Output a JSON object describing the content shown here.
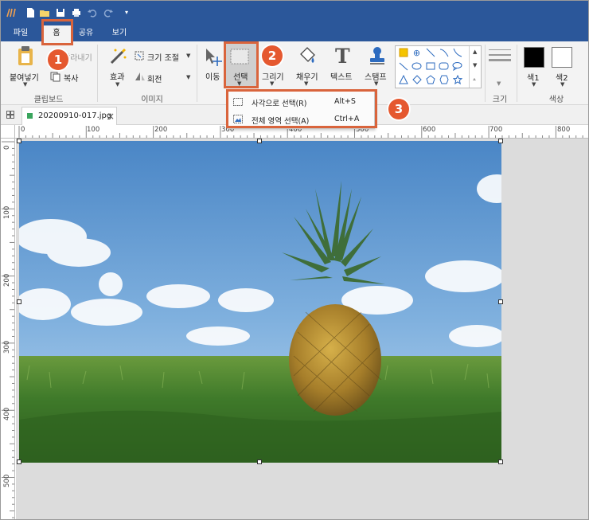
{
  "quick_access": {
    "icons": [
      "app-logo-icon",
      "new-icon",
      "open-icon",
      "save-icon",
      "print-icon",
      "undo-icon",
      "redo-icon",
      "customize-icon"
    ]
  },
  "tabs": [
    {
      "label": "파일",
      "active": false
    },
    {
      "label": "홈",
      "active": true
    },
    {
      "label": "공유",
      "active": false
    },
    {
      "label": "보기",
      "active": false
    }
  ],
  "ribbon": {
    "clipboard": {
      "paste": "붙여넣기",
      "cut": "잘라내기",
      "copy": "복사",
      "group_label": "클립보드"
    },
    "image": {
      "resize": "크기 조절",
      "effect": "효과",
      "rotate": "회전",
      "group_label": "이미지"
    },
    "tools": {
      "move": "이동",
      "select": "선택",
      "draw": "그리기",
      "fill": "채우기",
      "text": "텍스트",
      "stamp": "스탬프"
    },
    "shapes": [
      "select-box-icon",
      "crosshair-icon",
      "line-icon",
      "curve-icon",
      "arrow-line-icon",
      "ellipse-icon",
      "rectangle-icon",
      "rounded-rect-icon",
      "callout-icon",
      "triangle-icon",
      "diamond-icon",
      "pentagon-icon",
      "hexagon-icon",
      "star-icon"
    ],
    "size": {
      "group_label": "크기"
    },
    "color": {
      "color1": "색1",
      "color2": "색2",
      "group_label": "색상",
      "color1_value": "#000000",
      "color2_value": "#ffffff"
    }
  },
  "select_menu": {
    "items": [
      {
        "label": "사각으로 선택(R)",
        "shortcut": "Alt+S"
      },
      {
        "label": "전체 영역 선택(A)",
        "shortcut": "Ctrl+A"
      }
    ]
  },
  "document": {
    "tab_name": "20200910-017.jpg",
    "close": "×"
  },
  "ruler": {
    "h_labels": [
      "0",
      "100",
      "200",
      "300",
      "400",
      "500",
      "600",
      "700",
      "800"
    ],
    "v_labels": [
      "0",
      "100",
      "200",
      "300",
      "400",
      "500"
    ]
  },
  "callouts": [
    "1",
    "2",
    "3"
  ],
  "colors": {
    "titlebar": "#2b579a",
    "highlight": "#d9643c",
    "badge": "#e5582f",
    "workarea": "#dcdcdc"
  }
}
